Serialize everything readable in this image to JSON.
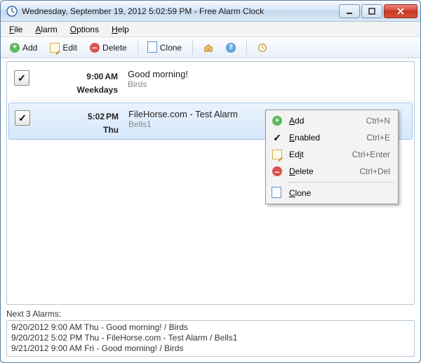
{
  "window": {
    "title": "Wednesday, September 19, 2012 5:02:59 PM - Free Alarm Clock"
  },
  "menu": {
    "file": "File",
    "alarm": "Alarm",
    "options": "Options",
    "help": "Help"
  },
  "toolbar": {
    "add": "Add",
    "edit": "Edit",
    "delete": "Delete",
    "clone": "Clone"
  },
  "alarms": [
    {
      "enabled": true,
      "time": "9:00",
      "ampm": "AM",
      "days": "Weekdays",
      "title": "Good morning!",
      "sound": "Birds"
    },
    {
      "enabled": true,
      "time": "5:02",
      "ampm": "PM",
      "days": "Thu",
      "title": "FileHorse.com - Test Alarm",
      "sound": "Bells1"
    }
  ],
  "context": {
    "add": "Add",
    "add_sc": "Ctrl+N",
    "enabled": "Enabled",
    "enabled_sc": "Ctrl+E",
    "edit": "Edit",
    "edit_sc": "Ctrl+Enter",
    "delete": "Delete",
    "delete_sc": "Ctrl+Del",
    "clone": "Clone"
  },
  "footer": {
    "label": "Next 3 Alarms:",
    "lines": [
      "9/20/2012 9:00 AM Thu - Good morning! / Birds",
      "9/20/2012 5:02 PM Thu - FileHorse.com - Test Alarm / Bells1",
      "9/21/2012 9:00 AM Fri - Good morning! / Birds"
    ]
  }
}
